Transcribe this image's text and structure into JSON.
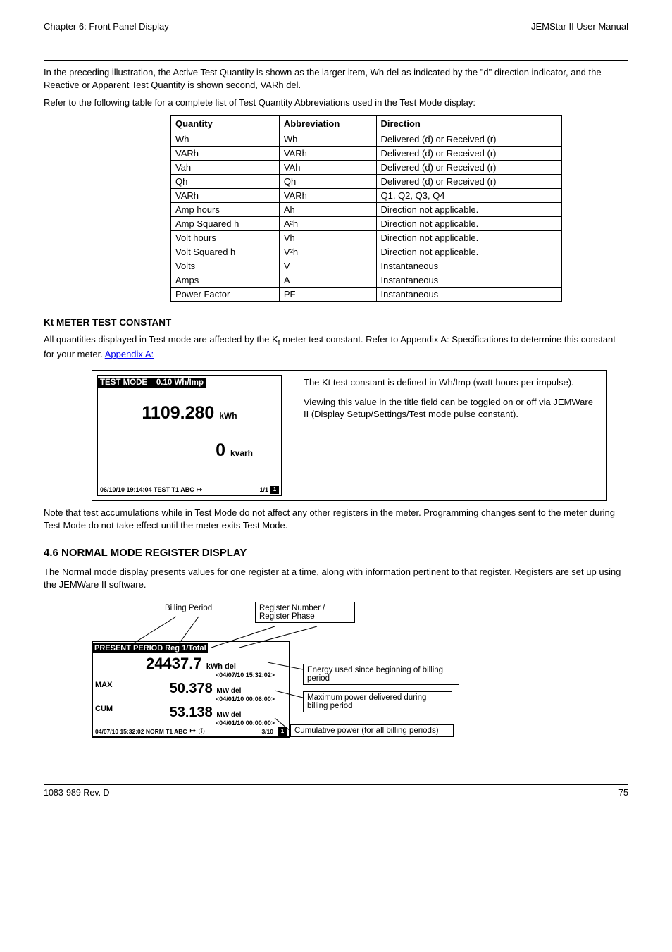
{
  "header": {
    "left": "Chapter 6: Front Panel Display",
    "right": "JEMStar II User Manual"
  },
  "intro": {
    "p1": "In the preceding illustration, the Active Test Quantity is shown as the larger item, Wh del as indicated by the \"d\" direction indicator, and the Reactive or Apparent Test Quantity is shown second, VARh del.",
    "p2": "Refer to the following table for a complete list of Test Quantity Abbreviations used in the Test Mode display:"
  },
  "table": {
    "headers": [
      "Quantity",
      "Abbreviation",
      "Direction"
    ],
    "rows": [
      [
        "Wh",
        "Wh",
        "Delivered (d) or Received (r)"
      ],
      [
        "VARh",
        "VARh",
        "Delivered (d) or Received (r)"
      ],
      [
        "Vah",
        "VAh",
        "Delivered (d) or Received (r)"
      ],
      [
        "Qh",
        "Qh",
        "Delivered (d) or Received (r)"
      ],
      [
        "VARh",
        "VARh",
        "Q1, Q2, Q3, Q4"
      ],
      [
        "Amp hours",
        "Ah",
        "Direction not applicable."
      ],
      [
        "Amp Squared h",
        "A²h",
        "Direction not applicable."
      ],
      [
        "Volt hours",
        "Vh",
        "Direction not applicable."
      ],
      [
        "Volt Squared h",
        "V²h",
        "Direction not applicable."
      ],
      [
        "Volts",
        "V",
        "Instantaneous"
      ],
      [
        "Amps",
        "A",
        "Instantaneous"
      ],
      [
        "Power Factor",
        "PF",
        "Instantaneous"
      ]
    ]
  },
  "kt_section": {
    "heading": "Kt METER TEST CONSTANT",
    "p1_prefix": "All quantities displayed in Test mode are affected by the K",
    "p1_suffix": " meter test constant. Refer to Appendix A: Specifications to determine this constant for your meter.",
    "xref": "Appendix A:"
  },
  "screen1": {
    "title_left": "TEST MODE",
    "title_right": "0.10  Wh/Imp",
    "row1_value": "1109.280",
    "row1_unit": "kWh",
    "row2_value": "0",
    "row2_unit": "kvarh",
    "footer": "06/10/10 19:14:04  TEST T1   ABC",
    "footer_right": "1/1",
    "footer_badge": "1",
    "side_p1": "The Kt test constant is defined in Wh/Imp (watt hours per impulse).",
    "side_p2": "Viewing this value in the title field can be toggled on or off via JEMWare II (Display Setup/Settings/Test mode pulse constant)."
  },
  "note": "Note that test accumulations while in Test Mode do not affect any other registers in the meter. Programming changes sent to the meter during Test Mode do not take effect until the meter exits Test Mode.",
  "normal": {
    "heading": "4.6  NORMAL MODE REGISTER DISPLAY",
    "p1": "The Normal mode display presents values for one register at a time, along with information pertinent to that register. Registers are set up using the JEMWare II software.",
    "callouts": {
      "period": "Billing Period",
      "regnum": "Register Number / Register Phase",
      "energy": "Energy used since beginning of billing period",
      "max": "Maximum power delivered during billing period",
      "cum": "Cumulative power (for all billing periods)"
    }
  },
  "screen2": {
    "title": "PRESENT PERIOD  Reg 1/Total",
    "row1_value": "24437.7",
    "row1_unit": "kWh del",
    "row1_ts": "<04/07/10 15:32:02>",
    "row2_label": "MAX",
    "row2_value": "50.378",
    "row2_unit": "MW del",
    "row2_ts": "<04/01/10 00:06:00>",
    "row3_label": "CUM",
    "row3_value": "53.138",
    "row3_unit": "MW del",
    "row3_ts": "<04/01/10 00:00:00>",
    "footer": "04/07/10 15:32:02  NORM T1  ABC",
    "footer_right": "3/10",
    "footer_badge": "1"
  },
  "footer": {
    "left": "1083-989  Rev. D",
    "right": "75"
  }
}
